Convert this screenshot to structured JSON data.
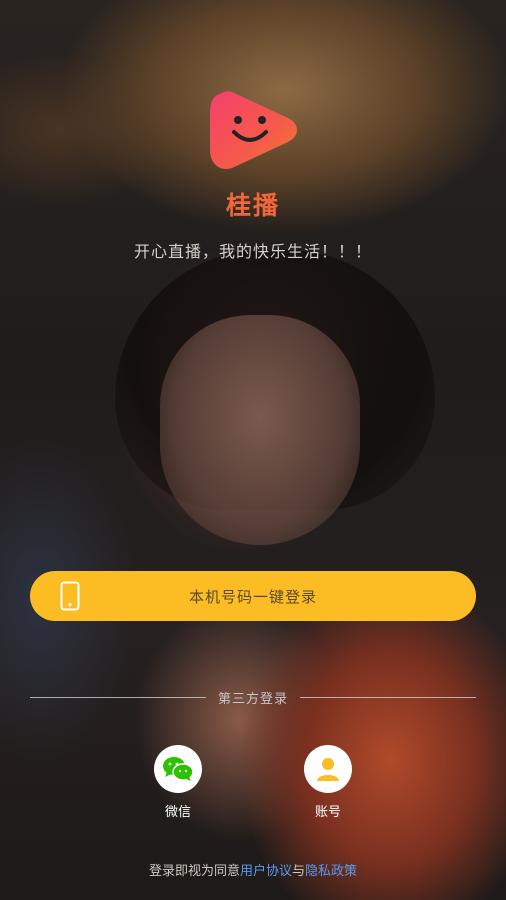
{
  "app": {
    "name": "桂播",
    "slogan": "开心直播，我的快乐生活！！！"
  },
  "login": {
    "one_key_label": "本机号码一键登录"
  },
  "third_party": {
    "title": "第三方登录",
    "options": [
      {
        "label": "微信",
        "icon": "wechat-icon"
      },
      {
        "label": "账号",
        "icon": "user-icon"
      }
    ]
  },
  "footer": {
    "prefix": "登录即视为同意",
    "user_agreement": "用户协议",
    "conjunction": "与",
    "privacy_policy": "隐私政策"
  },
  "colors": {
    "brand": "#f2673a",
    "button": "#fcbc24",
    "link": "#5a9cf0",
    "wechat": "#2dc100",
    "account": "#fcbc24"
  }
}
